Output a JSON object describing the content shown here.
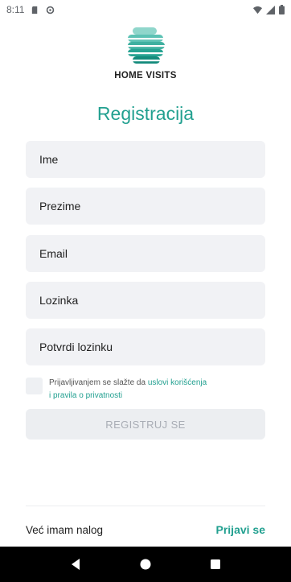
{
  "status_bar": {
    "time": "8:11",
    "left_icons": [
      "sd-card-icon",
      "sync-icon"
    ],
    "right_icons": [
      "wifi-icon",
      "signal-icon",
      "battery-icon"
    ]
  },
  "brand": {
    "logo_icon": "home-visits-logo-icon",
    "name": "HOME VISITS"
  },
  "form": {
    "title": "Registracija",
    "fields": [
      {
        "placeholder": "Ime"
      },
      {
        "placeholder": "Prezime"
      },
      {
        "placeholder": "Email"
      },
      {
        "placeholder": "Lozinka"
      },
      {
        "placeholder": "Potvrdi lozinku"
      }
    ],
    "terms": {
      "prefix": "Prijavljivanjem se slažte da ",
      "link": "uslovi korišćenja",
      "line2": "i pravila o privatnosti"
    },
    "register_label": "REGISTRUJ SE"
  },
  "footer": {
    "has_account_text": "Već imam nalog",
    "login_label": "Prijavi se"
  },
  "nav_bar": {
    "icons": [
      "back-icon",
      "home-icon",
      "recents-icon"
    ]
  },
  "colors": {
    "accent": "#22a090",
    "field_bg": "#f1f2f5",
    "disabled_text": "#a9adb5"
  }
}
